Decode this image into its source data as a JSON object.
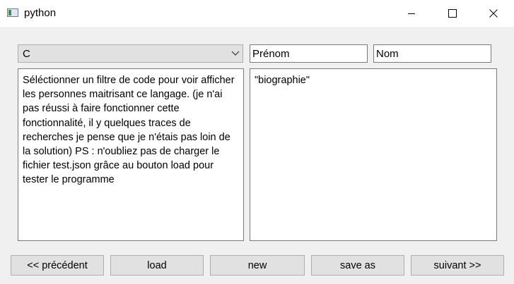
{
  "window": {
    "title": "python",
    "controls": {
      "minimize": "minimize",
      "maximize": "maximize",
      "close": "close"
    }
  },
  "filter_select": {
    "selected": "C"
  },
  "fields": {
    "prenom_placeholder": "Prénom",
    "nom_placeholder": "Nom"
  },
  "description_text": "Séléctionner un filtre de code pour voir afficher les personnes maitrisant ce langage. (je n'ai pas réussi à faire fonctionner cette fonctionnalité, il y quelques traces de recherches je pense que je n'étais pas loin de la solution) PS : n'oubliez pas de charger le fichier test.json grâce au bouton load pour tester le programme",
  "biography_text": "\"biographie\"",
  "buttons": {
    "previous": "<< précédent",
    "load": "load",
    "new": "new",
    "save_as": "save as",
    "next": "suivant >>"
  }
}
